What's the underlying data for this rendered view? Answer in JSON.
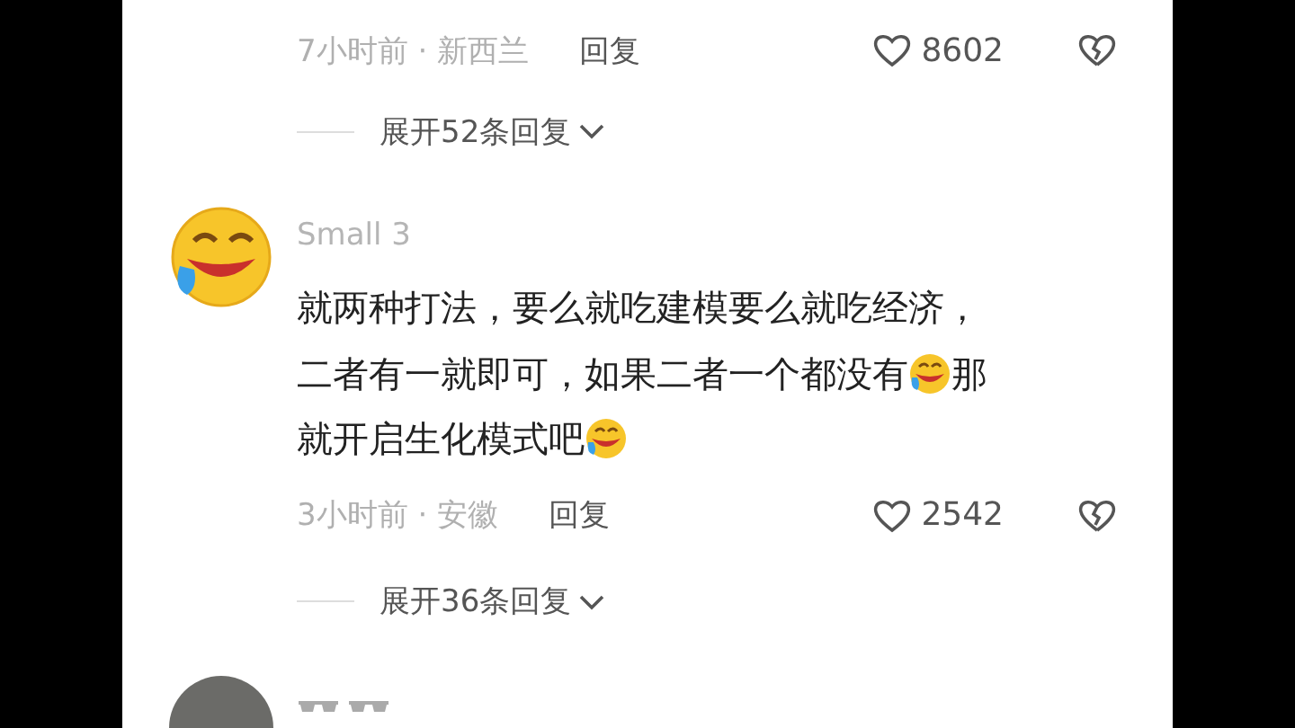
{
  "comments": [
    {
      "kind": "cropped",
      "meta": {
        "time": "7小时前 · 新西兰",
        "reply": "回复",
        "likes": "8602"
      },
      "expand": "展开52条回复"
    },
    {
      "kind": "emoji",
      "username": "Small 3",
      "lines": [
        [
          {
            "kind": "text",
            "text": "就两种打法，要么就吃建模要么就吃经济，"
          }
        ],
        [
          {
            "kind": "text",
            "text": "二者有一就即可，如果二者一个都没有"
          },
          {
            "kind": "emoji"
          },
          {
            "kind": "text",
            "text": "那"
          }
        ],
        [
          {
            "kind": "text",
            "text": "就开启生化模式吧"
          },
          {
            "kind": "emoji"
          }
        ]
      ],
      "meta": {
        "time": "3小时前 · 安徽",
        "reply": "回复",
        "likes": "2542"
      },
      "expand": "展开36条回复"
    },
    {
      "kind": "photo",
      "username_icons": [
        {
          "kind": "glasses"
        },
        {
          "kind": "glasses"
        }
      ]
    }
  ]
}
